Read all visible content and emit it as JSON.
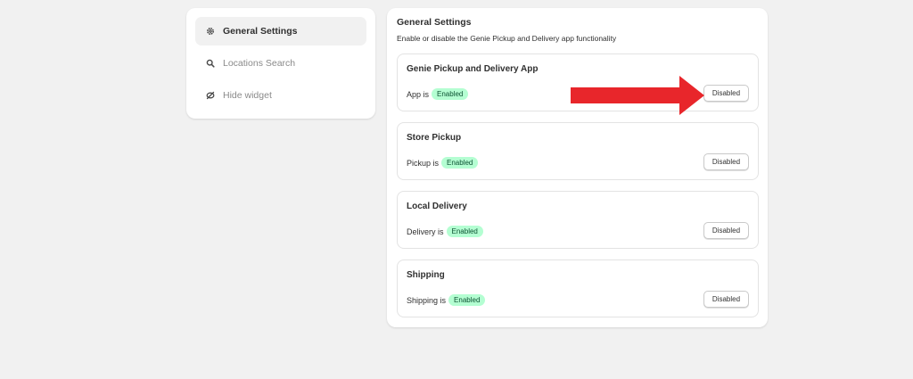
{
  "sidebar": {
    "items": [
      {
        "label": "General Settings",
        "icon": "gear-icon",
        "active": true
      },
      {
        "label": "Locations Search",
        "icon": "search-icon",
        "active": false
      },
      {
        "label": "Hide widget",
        "icon": "hide-icon",
        "active": false
      }
    ]
  },
  "main": {
    "title": "General Settings",
    "subtitle": "Enable or disable the Genie Pickup and Delivery app functionality",
    "cards": [
      {
        "title": "Genie Pickup and Delivery App",
        "status_prefix": "App is",
        "badge": "Enabled",
        "button": "Disabled"
      },
      {
        "title": "Store Pickup",
        "status_prefix": "Pickup is",
        "badge": "Enabled",
        "button": "Disabled"
      },
      {
        "title": "Local Delivery",
        "status_prefix": "Delivery is",
        "badge": "Enabled",
        "button": "Disabled"
      },
      {
        "title": "Shipping",
        "status_prefix": "Shipping is",
        "badge": "Enabled",
        "button": "Disabled"
      }
    ]
  },
  "colors": {
    "page_bg": "#f1f1f1",
    "badge_bg": "#b4fed2",
    "badge_text": "#0c5132",
    "annotation_arrow": "#e8262b"
  }
}
